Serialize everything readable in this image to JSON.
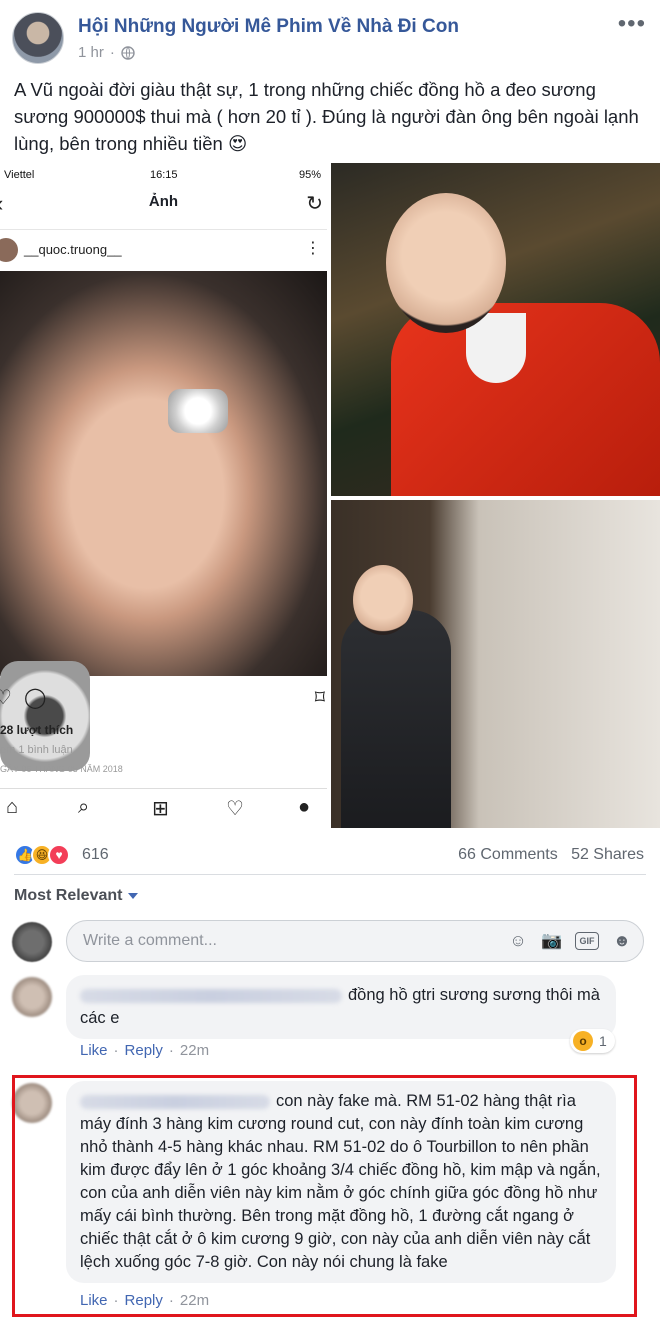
{
  "post": {
    "group_name": "Hội Những Người Mê Phim Về Nhà Đi Con",
    "time": "1 hr",
    "privacy_icon": "globe-icon",
    "more_icon": "more-dots-icon",
    "text": "A Vũ ngoài đời giàu thật sự, 1 trong những chiếc đồng hồ a đeo sương sương 900000$ thui mà ( hơn 20 tỉ ). Đúng là người đàn ông bên ngoài lạnh lùng, bên trong nhiều tiền 😍"
  },
  "screenshot_photo": {
    "carrier": "Viettel",
    "clock": "16:15",
    "battery": "95%",
    "title": "Ảnh",
    "username": "__quoc.truong__",
    "likes": "28 lượt thích",
    "comments": "em 1 bình luận",
    "date": "GÀY 06 THÁNG 05 NĂM 2018"
  },
  "stats": {
    "reaction_count": "616",
    "comments": "66 Comments",
    "shares": "52 Shares",
    "reaction_icons": [
      "like-icon",
      "haha-icon",
      "love-icon"
    ]
  },
  "comments_section": {
    "sort_label": "Most Relevant",
    "write_placeholder": "Write a comment...",
    "input_icons": [
      "emoji-icon",
      "camera-icon",
      "gif-icon",
      "sticker-icon"
    ]
  },
  "comments": [
    {
      "text": "đồng hồ gtri sương sương thôi mà các e",
      "like": "Like",
      "reply": "Reply",
      "time": "22m",
      "reaction_count": "1"
    },
    {
      "text": "con này fake mà. RM 51-02 hàng thật rìa máy đính 3 hàng kim cương round cut, con này đính toàn kim cương nhỏ thành 4-5 hàng khác nhau. RM 51-02 do ô Tourbillon to nên phần kim được đẩy lên ở 1 góc khoảng 3/4 chiếc đồng hồ, kim mập và ngắn, con của anh diễn viên này kim nằm ở góc chính giữa góc đồng hồ như mấy cái bình thường. Bên trong mặt đồng hồ, 1 đường cắt ngang ở chiếc thật cắt ở ô kim cương 9 giờ, con này của anh diễn viên này cắt lệch xuống góc 7-8 giờ. Con này nói chung là fake",
      "like": "Like",
      "reply": "Reply",
      "time": "22m"
    }
  ]
}
